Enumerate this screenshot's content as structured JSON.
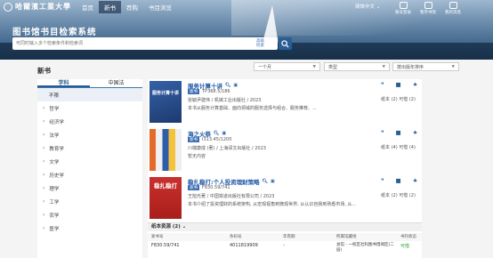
{
  "header": {
    "logo_text": "哈爾濱工業大學",
    "nav": [
      "首页",
      "新书",
      "荐购",
      "书目浏览"
    ],
    "active_nav": 1,
    "lang": "简体中文 ⌄",
    "tools": [
      "账号登录",
      "暂存书架",
      "我的消息"
    ],
    "system_title": "图书馆书目检索系统",
    "search_placeholder": "可同时输入多个检索条件和检索词",
    "adv_search_label": "高级\n检索"
  },
  "page": {
    "title": "新书",
    "selects": [
      "一个月",
      "类型",
      "按出版年排序"
    ]
  },
  "filter": {
    "tabs": [
      "学科",
      "中国法"
    ],
    "items": [
      "不限",
      "哲学",
      "经济学",
      "法学",
      "教育学",
      "文学",
      "历史学",
      "理学",
      "工学",
      "农学",
      "医学"
    ]
  },
  "books": [
    {
      "title": "服务计算十讲",
      "call_number": "TP368.5/186",
      "publisher": "张毓尹建伟 / 机械工业出版社 / 2023",
      "summary": "本书从服务计算基础、面向领域的服务选择与组合、服务推荐、...",
      "stock": "纸本 (2)   可借 (2)",
      "cover_color": "#2a4e8c",
      "cover_text": "服务计算十讲"
    },
    {
      "title": "海之火祭",
      "call_number": "I313.45/1200",
      "publisher": "川端康成 (著) / 上海译文出版社 / 2023",
      "summary": "暂无内容",
      "stock": "纸本 (4)   可借 (4)",
      "cover_color": "#d8d8d8",
      "cover_text": ""
    },
    {
      "title": "稳扎稳打:个人投资理财策略",
      "call_number": "F830.59/741",
      "publisher": "王旭光著 / 中国铁道出版社有限公司 / 2023",
      "summary": "本书介绍了投资理财的系统架构, 从宏观视角到微观世界, 从认识自我到熟悉市场, 从...",
      "stock": "纸本 (2)   可借 (2)",
      "cover_color": "#c9302c",
      "cover_text": "稳扎稳打"
    }
  ],
  "holdings": {
    "header": "纸本资源 (2) ⌄",
    "columns": [
      "索书号",
      "条码号",
      "年卷期",
      "所属馆藏地",
      "书刊状态"
    ],
    "row": {
      "call_number": "F830.59/741",
      "barcode": "4011819909",
      "issue": "-",
      "location": "总馆 - 一校区社科图书借阅区(二层)",
      "status": "可借"
    }
  },
  "icons": [
    "quote-icon",
    "folder-icon",
    "star-icon",
    "search-icon",
    "user-icon",
    "bookshelf-icon",
    "message-icon"
  ]
}
